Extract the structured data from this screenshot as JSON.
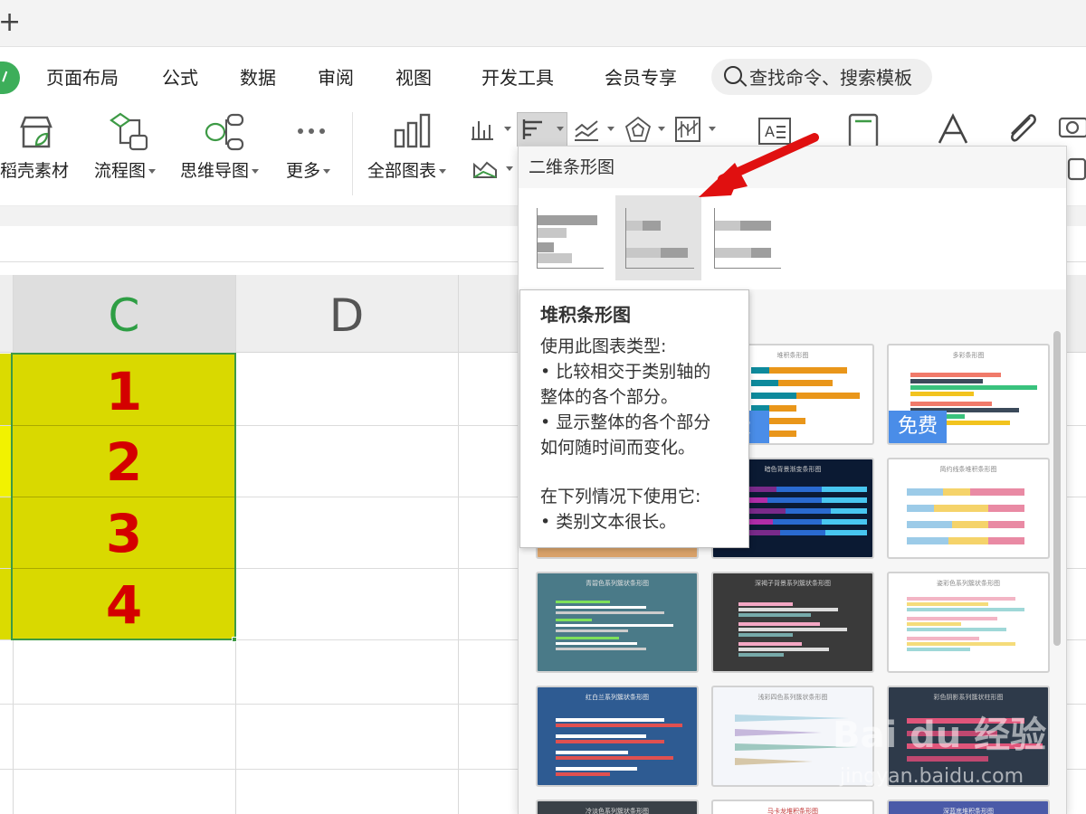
{
  "tabs": {
    "new_tab": "+"
  },
  "menu": [
    "页面布局",
    "公式",
    "数据",
    "审阅",
    "视图",
    "开发工具",
    "会员专享"
  ],
  "search": {
    "placeholder": "查找命令、搜索模板"
  },
  "ribbon": {
    "daoke": "稻壳素材",
    "flowchart": "流程图",
    "mindmap": "思维导图",
    "more": "更多",
    "all_charts": "全部图表"
  },
  "sheet": {
    "col_c": "C",
    "col_d": "D",
    "values": [
      "1",
      "2",
      "3",
      "4"
    ],
    "fill_color": "#d9d900",
    "text_color": "#d40000"
  },
  "panel": {
    "title": "二维条形图",
    "badge": "免费",
    "badge_partial": "费",
    "thumbs": [
      "堆积条形图",
      "多彩条形图",
      "暗色背景渐变条形图",
      "简约线条堆积条形图",
      "青碧色系列簇状条形图",
      "深褐子背景系列簇状条形图",
      "姿彩色系列簇状条形图",
      "红白兰系列簇状条形图",
      "浅彩四色系列簇状条形图",
      "彩色阴影系列簇状柱形图",
      "冷淡色系列簇状条形图",
      "马卡龙堆积条形图",
      "深蓝底堆积条形图"
    ]
  },
  "tooltip": {
    "title": "堆积条形图",
    "lines": [
      "使用此图表类型:",
      "• 比较相交于类别轴的",
      "整体的各个部分。",
      "• 显示整体的各个部分",
      "如何随时间而变化。"
    ],
    "lines2": [
      "在下列情况下使用它:",
      "• 类别文本很长。"
    ]
  },
  "watermark": {
    "brand": "Bai du 经验",
    "url": "jingyan.baidu.com"
  },
  "colors": {
    "accent_green": "#3d9a45",
    "arrow_red": "#e01010",
    "badge_blue": "#4a8de8"
  }
}
